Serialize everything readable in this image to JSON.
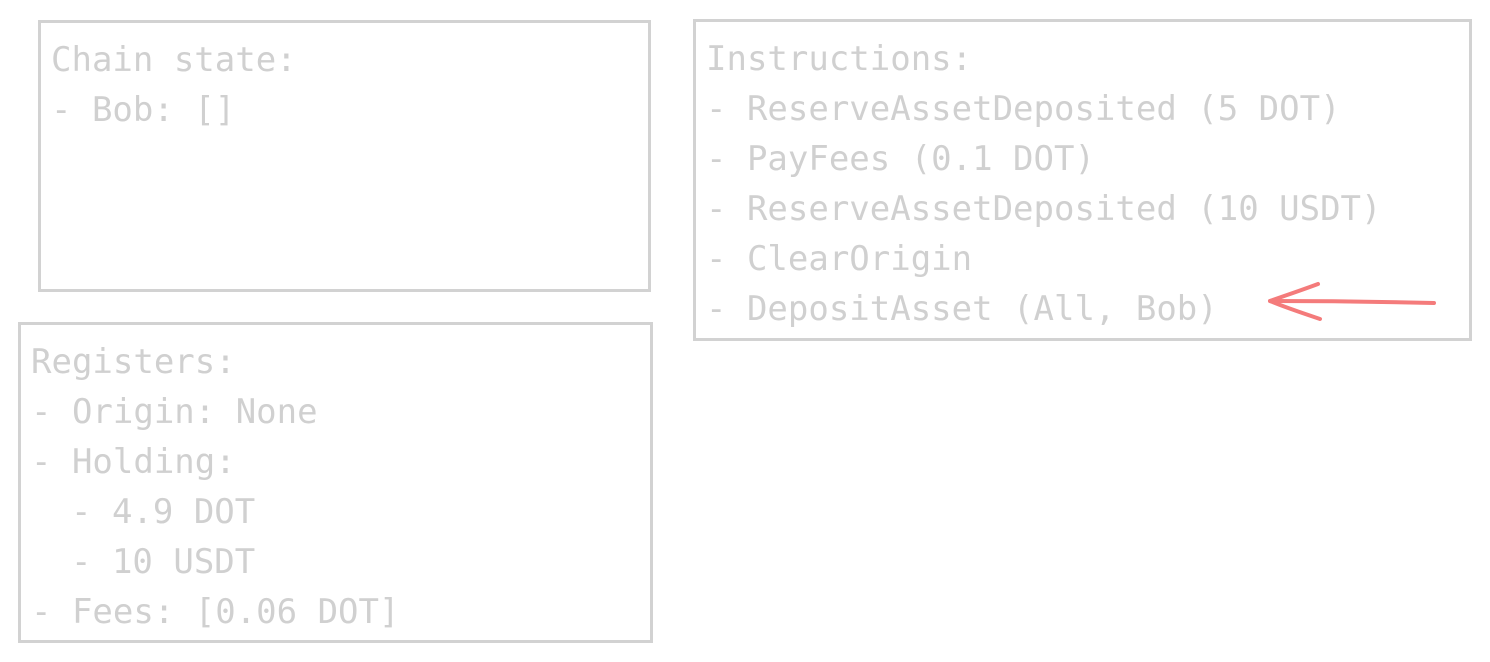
{
  "chain_state": {
    "title": "Chain state:",
    "lines": [
      "- Bob: []"
    ]
  },
  "registers": {
    "title": "Registers:",
    "origin": "- Origin: None",
    "holding": "- Holding:",
    "holding_items": [
      "- 4.9 DOT",
      "- 10 USDT"
    ],
    "fees": "- Fees: [0.06 DOT]"
  },
  "instructions": {
    "title": "Instructions:",
    "items": [
      "- ReserveAssetDeposited (5 DOT)",
      "- PayFees (0.1 DOT)",
      "- ReserveAssetDeposited (10 USDT)",
      "- ClearOrigin",
      "- DepositAsset (All, Bob)"
    ],
    "current_index": 4
  },
  "colors": {
    "text": "#d0d0d0",
    "border": "#d2d2d2",
    "arrow": "#f47b7b"
  }
}
